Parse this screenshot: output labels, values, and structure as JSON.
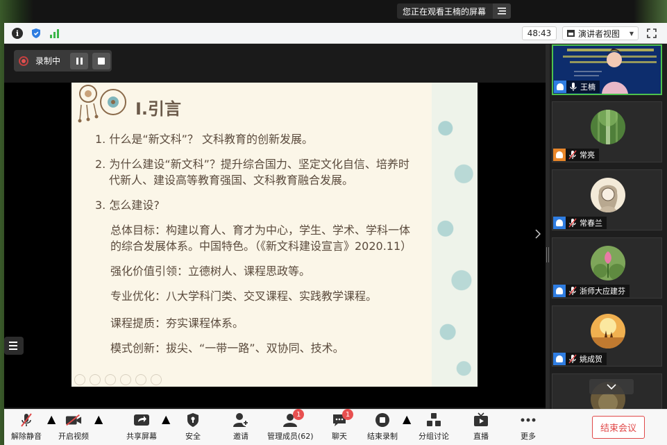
{
  "banner": {
    "text": "您正在观看王楠的屏幕",
    "menu_icon": "list-menu-icon"
  },
  "topbar": {
    "icons": [
      "info-icon",
      "shield-icon",
      "signal-icon"
    ],
    "timer": "48:43",
    "view_label": "演讲者视图",
    "fullscreen_icon": "fullscreen-icon"
  },
  "recording": {
    "label": "录制中"
  },
  "slide": {
    "title": "I.引言",
    "lines": [
      "1.  什么是“新文科”？   文科教育的创新发展。",
      "2.  为什么建设“新文科”？提升综合国力、坚定文化自信、培养时",
      "代新人、建设高等教育强国、文科教育融合发展。",
      "3. 怎么建设?",
      "总体目标：构建以育人、育才为中心，学生、学术、学科一体",
      "的综合发展体系。中国特色。（《新文科建设宣言》2020.11）",
      "强化价值引领：立德树人、课程思政等。",
      "专业优化：八大学科门类、交叉课程、实践教学课程。",
      "课程提质：夯实课程体系。",
      "模式创新：拔尖、“一带一路”、双协同、技术。"
    ]
  },
  "participants": [
    {
      "name": "王楠",
      "speaking": true
    },
    {
      "name": "常亮",
      "speaking": false
    },
    {
      "name": "常春兰",
      "speaking": false
    },
    {
      "name": "浙师大应建芬",
      "speaking": false
    },
    {
      "name": "姚成贺",
      "speaking": false
    }
  ],
  "toolbar": {
    "unmute": "解除静音",
    "start_video": "开启视频",
    "share_screen": "共享屏幕",
    "security": "安全",
    "invite": "邀请",
    "manage_members": "管理成员(62)",
    "members_badge": "1",
    "chat": "聊天",
    "chat_badge": "1",
    "end_recording": "结束录制",
    "breakout": "分组讨论",
    "live": "直播",
    "more": "更多",
    "end_meeting": "结束会议"
  },
  "colors": {
    "accent_green": "#4dc24d",
    "end_red": "#e04848",
    "badge_red": "#e85050",
    "person_blue": "#2f7de1"
  }
}
